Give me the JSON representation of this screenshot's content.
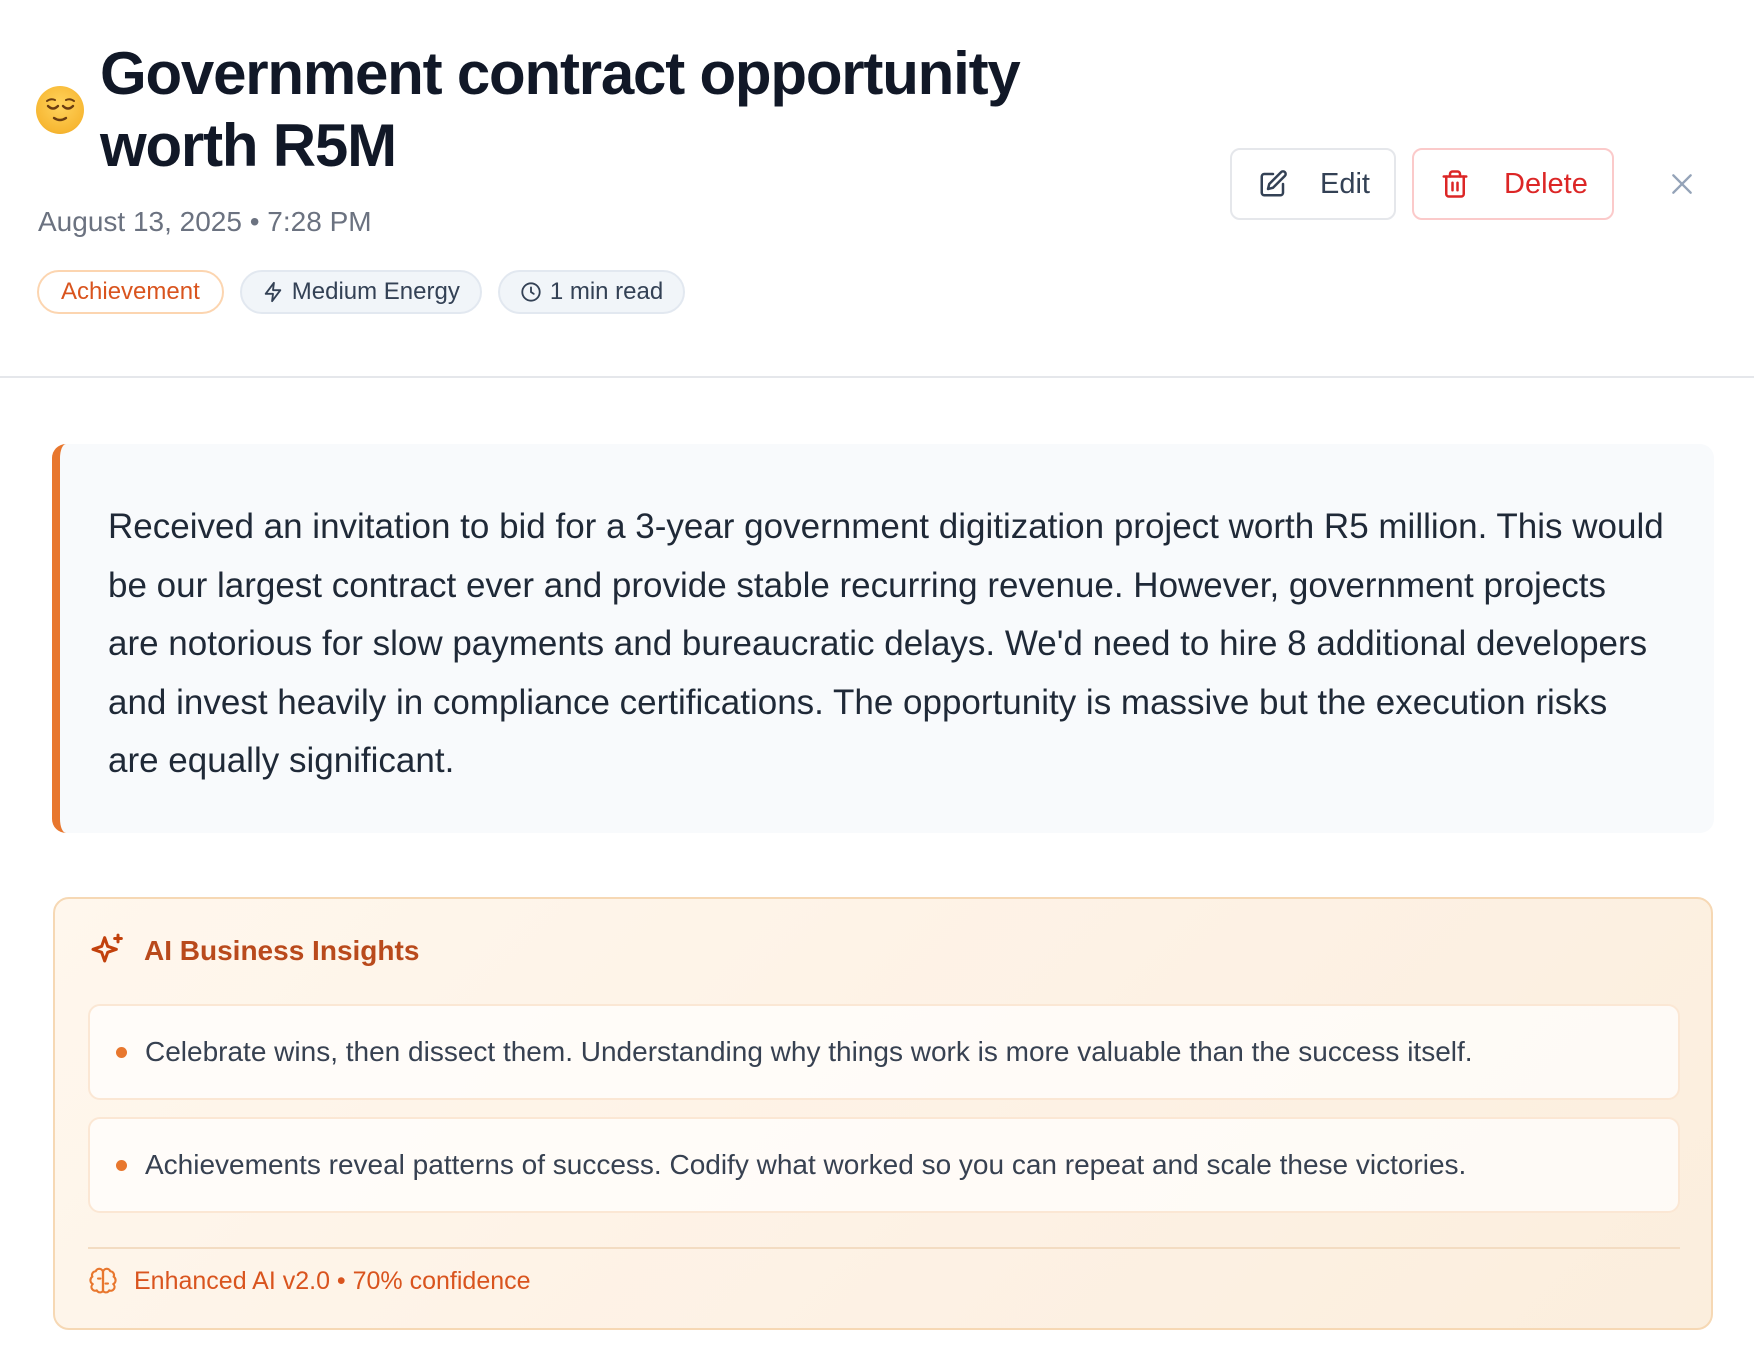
{
  "entry": {
    "mood_icon": "relieved-face-emoji",
    "title": "Government contract opportunity worth R5M",
    "date_time": "August 13, 2025 • 7:28 PM",
    "tags": {
      "category": "Achievement",
      "energy": "Medium Energy",
      "read_time": "1 min read"
    },
    "content": "Received an invitation to bid for a 3-year government digitization project worth R5 million. This would be our largest contract ever and provide stable recurring revenue. However, government projects are notorious for slow payments and bureaucratic delays. We'd need to hire 8 additional developers and invest heavily in compliance certifications. The opportunity is massive but the execution risks are equally significant."
  },
  "actions": {
    "edit_label": "Edit",
    "delete_label": "Delete",
    "close_icon": "close-icon"
  },
  "insights": {
    "title": "AI Business Insights",
    "items": [
      "Celebrate wins, then dissect them. Understanding why things work is more valuable than the success itself.",
      "Achievements reveal patterns of success. Codify what worked so you can repeat and scale these victories."
    ],
    "footer": "Enhanced AI v2.0 • 70% confidence"
  },
  "colors": {
    "accent": "#e8772e",
    "delete": "#dc2626",
    "insight_title": "#b94a1c"
  }
}
